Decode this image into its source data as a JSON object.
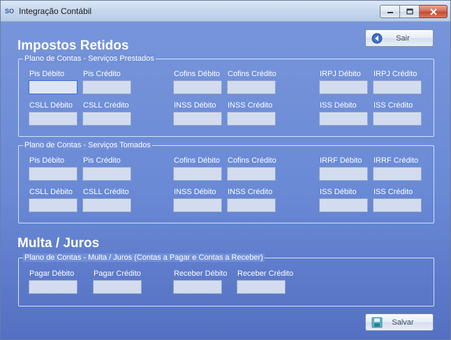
{
  "window": {
    "title": "Integração Contábil"
  },
  "impostos": {
    "heading": "Impostos Retidos",
    "prestados": {
      "legend": "Plano de Contas - Serviços Prestados",
      "fields": [
        "Pis Débito",
        "Pis Crédito",
        "Cofins Débito",
        "Cofins Crédito",
        "IRPJ Débito",
        "IRPJ Crédito",
        "CSLL Débito",
        "CSLL Crédito",
        "INSS Débito",
        "INSS Crédito",
        "ISS Débito",
        "ISS Crédito"
      ]
    },
    "tomados": {
      "legend": "Plano de Contas - Serviços Tomados",
      "fields": [
        "Pis Débito",
        "Pis Crédito",
        "Cofins Débito",
        "Cofins Crédito",
        "IRRF Débito",
        "IRRF Crédito",
        "CSLL Débito",
        "CSLL Crédito",
        "INSS Débito",
        "INSS Crédito",
        "ISS Débito",
        "ISS Crédito"
      ]
    }
  },
  "multa": {
    "heading": "Multa / Juros",
    "legend": "Plano de Contas -  Multa / Juros (Contas a Pagar e Contas a Receber)",
    "fields": [
      "Pagar Débito",
      "Pagar Crédito",
      "Receber Débito",
      "Receber Crédito"
    ]
  },
  "buttons": {
    "sair": "Sair",
    "salvar": "Salvar"
  },
  "colors": {
    "accent": "#3b6fcf",
    "window_bg": "#6f8fd9",
    "close_button": "#c44a2f"
  }
}
